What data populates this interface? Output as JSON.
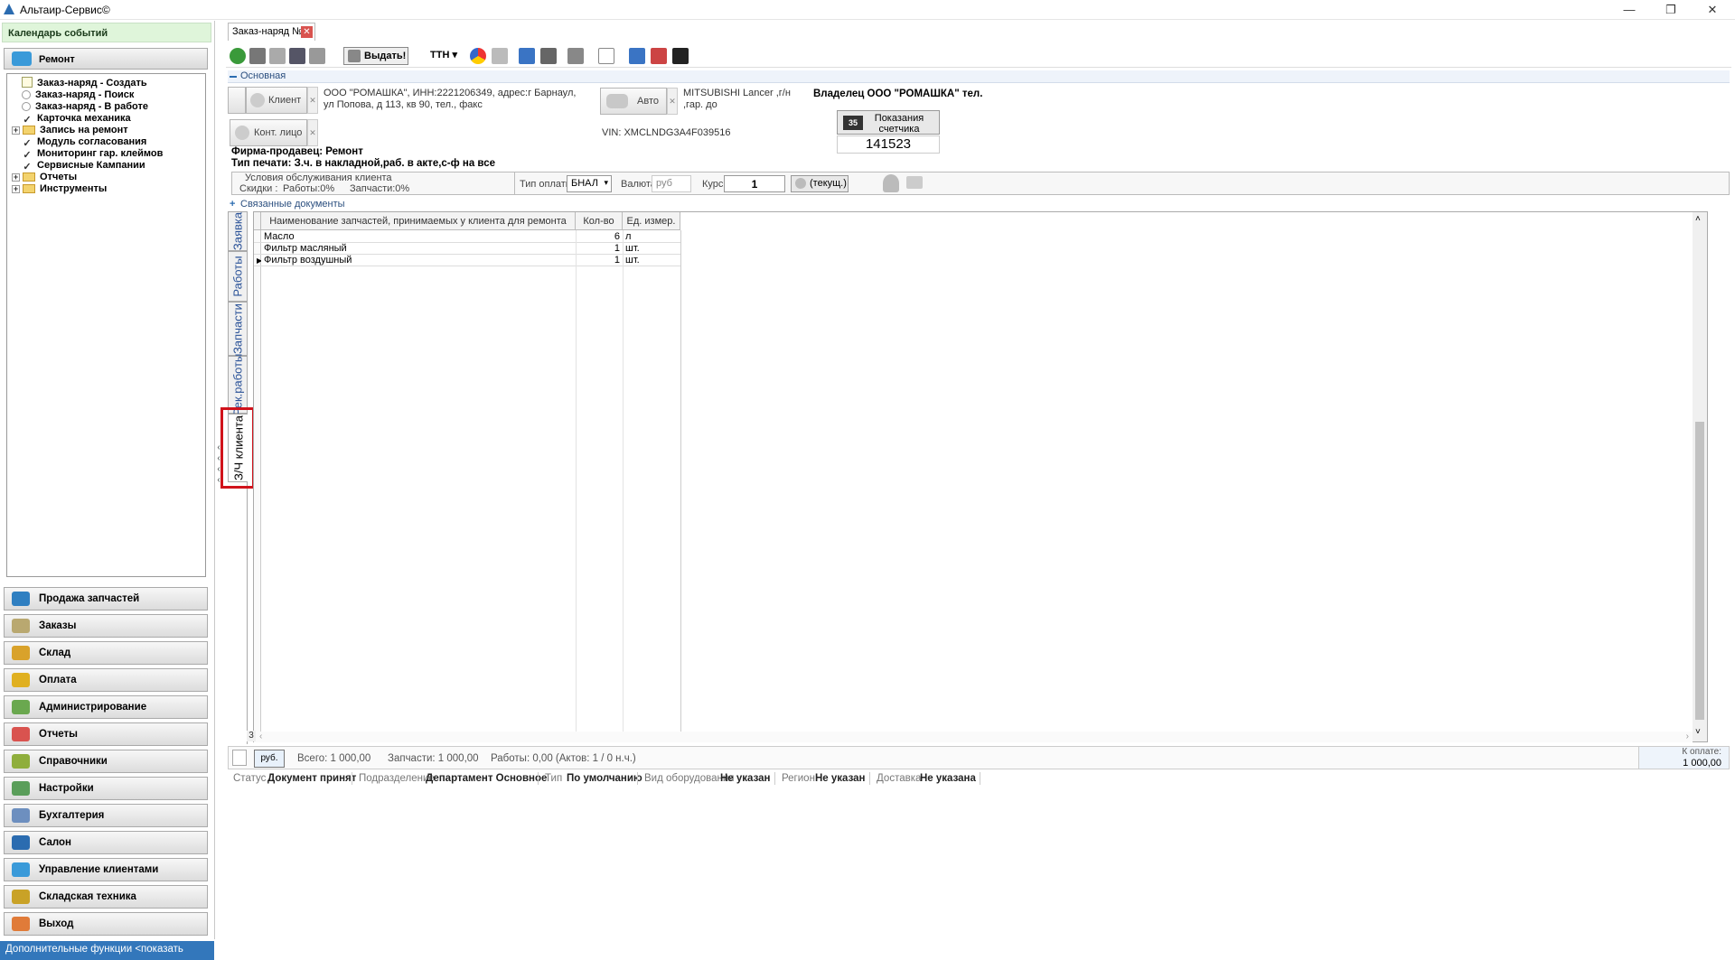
{
  "window": {
    "title": "Альтаир-Сервис©",
    "minimize": "—",
    "maximize": "❐",
    "close": "✕"
  },
  "left": {
    "calendar": "Календарь событий",
    "repair": "Ремонт",
    "tree": [
      {
        "label": "Заказ-наряд - Создать",
        "icon": "doc-icon"
      },
      {
        "label": "Заказ-наряд - Поиск",
        "icon": "circle-icon"
      },
      {
        "label": "Заказ-наряд - В работе",
        "icon": "circle-icon"
      },
      {
        "label": "Карточка механика",
        "icon": "check-icon"
      },
      {
        "label": "Запись на ремонт",
        "icon": "folder-icon"
      },
      {
        "label": "Модуль согласования",
        "icon": "check-icon"
      },
      {
        "label": "Мониторинг гар. клеймов",
        "icon": "check-icon"
      },
      {
        "label": "Сервисные Кампании",
        "icon": "check-icon"
      },
      {
        "label": "Отчеты",
        "icon": "folder-icon"
      },
      {
        "label": "Инструменты",
        "icon": "folder-icon"
      }
    ],
    "nav": [
      {
        "label": "Продажа запчастей",
        "color": "#2f7fc1"
      },
      {
        "label": "Заказы",
        "color": "#b9a870"
      },
      {
        "label": "Склад",
        "color": "#d9a22b"
      },
      {
        "label": "Оплата",
        "color": "#e0b020"
      },
      {
        "label": "Администрирование",
        "color": "#6aa84f"
      },
      {
        "label": "Отчеты",
        "color": "#d9534f"
      },
      {
        "label": "Справочники",
        "color": "#8fae3c"
      },
      {
        "label": "Настройки",
        "color": "#5a9e5a"
      },
      {
        "label": "Бухгалтерия",
        "color": "#6d8fbf"
      },
      {
        "label": "Салон",
        "color": "#2b6cb0"
      },
      {
        "label": "Управление клиентами",
        "color": "#3a9ad9"
      },
      {
        "label": "Складская техника",
        "color": "#c9a227"
      },
      {
        "label": "Выход",
        "color": "#e07b39"
      }
    ],
    "more": "Дополнительные функции <показать"
  },
  "doc": {
    "tab": "Заказ-наряд №5",
    "tab_close": "✕",
    "issue_btn": "Выдать!",
    "tth": "ТТН",
    "section_main": "Основная",
    "client_btn": "Клиент",
    "client_info": "ООО \"РОМАШКА\", ИНН:2221206349, адрес:г Барнаул, ул Попова, д 113, кв 90, тел., факс",
    "contact_btn": "Конт. лицо",
    "auto_btn": "Авто",
    "auto_info": "MITSUBISHI Lancer ,г/н ,гар. до",
    "vin": "VIN: XMCLNDG3A4F039516",
    "owner": "Владелец  ООО \"РОМАШКА\" тел.",
    "counter_label": "Показания счетчика",
    "counter_value": "141523",
    "seller": "Фирма-продавец: Ремонт",
    "print_type": "Тип печати: З.ч. в накладной,раб. в акте,с-ф на все",
    "conditions_title": "Условия обслуживания клиента",
    "discounts": "Скидки :",
    "works_disc": "Работы:0%",
    "parts_disc": "Запчасти:0%",
    "pay_type_label": "Тип оплаты",
    "pay_type": "БНАЛ",
    "currency_label": "Валюта",
    "currency": "руб",
    "rate_label": "Курс",
    "rate": "1",
    "rate_btn": "(текущ.)",
    "section_linked": "Связанные документы",
    "vtabs": [
      "Заявка",
      "Работы",
      "Запчасти",
      "Рек.работы",
      "З/Ч клиента"
    ],
    "grid": {
      "headers": [
        "Наименование запчастей, принимаемых у клиента для ремонта",
        "Кол-во",
        "Ед. измер."
      ],
      "rows": [
        [
          "Масло",
          "6",
          "л"
        ],
        [
          "Фильтр масляный",
          "1",
          "шт."
        ],
        [
          "Фильтр воздушный",
          "1",
          "шт."
        ]
      ],
      "row_count": "3"
    },
    "totals": {
      "rub": "руб.",
      "total": "Всего: 1 000,00",
      "parts": "Запчасти: 1 000,00",
      "works": "Работы: 0,00 (Актов: 1 / 0 н.ч.)",
      "to_pay_label": "К оплате:",
      "to_pay": "1 000,00"
    },
    "status": [
      {
        "label": "Статус",
        "value": "Документ принят"
      },
      {
        "label": "Подразделение",
        "value": "Департамент Основное"
      },
      {
        "label": "Тип",
        "value": "По умолчанию"
      },
      {
        "label": "Вид оборудования",
        "value": "Не указан"
      },
      {
        "label": "Регион",
        "value": "Не указан"
      },
      {
        "label": "Доставка",
        "value": "Не указана"
      }
    ]
  }
}
